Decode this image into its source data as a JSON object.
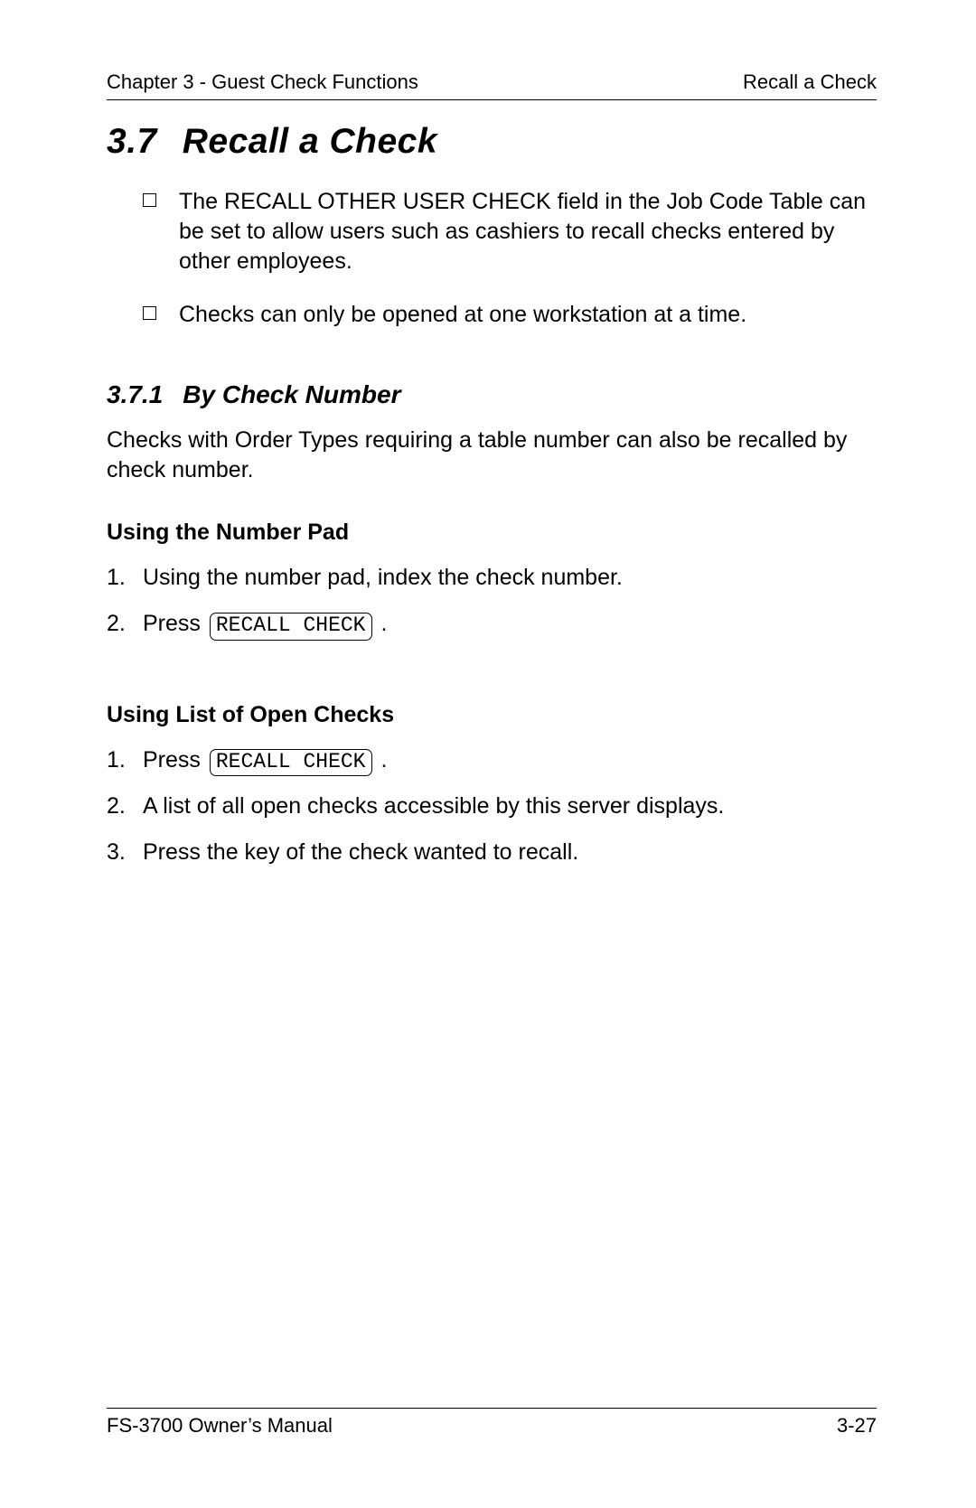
{
  "header": {
    "left": "Chapter 3 - Guest Check Functions",
    "right": "Recall a Check"
  },
  "section": {
    "number": "3.7",
    "title": "Recall a Check"
  },
  "bullets": [
    "The RECALL OTHER USER CHECK field in the Job Code Table can be set to allow users such as cashiers to recall checks entered by other employees.",
    "Checks can only be opened at one workstation at a time."
  ],
  "subsection": {
    "number": "3.7.1",
    "title": "By Check Number",
    "intro": "Checks with Order Types requiring a table number can also be recalled by check number."
  },
  "block1": {
    "heading": "Using the Number Pad",
    "step1": "Using the number pad, index the check number.",
    "step2_prefix": "Press ",
    "step2_key": "RECALL CHECK",
    "step2_suffix": " ."
  },
  "block2": {
    "heading": "Using List of Open Checks",
    "step1_prefix": "Press ",
    "step1_key": "RECALL CHECK",
    "step1_suffix": " .",
    "step2": "A list of all open checks accessible by this server displays.",
    "step3": "Press the key of the check wanted to recall."
  },
  "footer": {
    "left": "FS-3700 Owner’s Manual",
    "right": "3-27"
  }
}
